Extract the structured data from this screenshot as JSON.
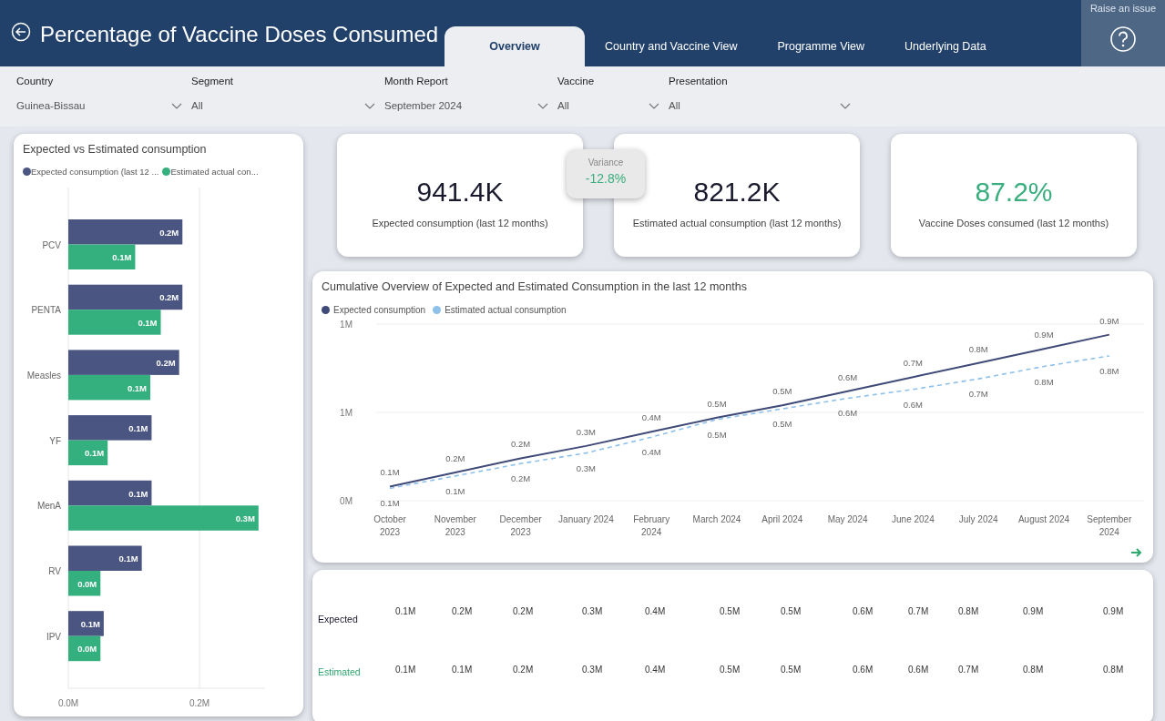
{
  "header": {
    "title": "Percentage of Vaccine Doses Consumed",
    "tabs": [
      {
        "label": "Overview",
        "selected": true
      },
      {
        "label": "Country and Vaccine View",
        "selected": false
      },
      {
        "label": "Programme View",
        "selected": false
      },
      {
        "label": "Underlying Data",
        "selected": false
      }
    ],
    "help": {
      "label": "Raise an issue"
    }
  },
  "filters": [
    {
      "label": "Country",
      "value": "Guinea-Bissau"
    },
    {
      "label": "Segment",
      "value": "All"
    },
    {
      "label": "Month Report",
      "value": "September 2024"
    },
    {
      "label": "Vaccine",
      "value": "All"
    },
    {
      "label": "Presentation",
      "value": "All"
    }
  ],
  "bar_card": {
    "chart_data": {
      "type": "bar",
      "title": "Expected vs Estimated consumption",
      "orientation": "horizontal",
      "categories": [
        "PCV",
        "PENTA",
        "Measles",
        "YF",
        "MenA",
        "RV",
        "IPV"
      ],
      "series": [
        {
          "name": "Expected consumption (last 12 ...",
          "color": "#4a5582",
          "values": [
            0.174,
            0.174,
            0.169,
            0.127,
            0.127,
            0.112,
            0.054
          ]
        },
        {
          "name": "Estimated actual con...",
          "color": "#34b07e",
          "values": [
            0.102,
            0.141,
            0.125,
            0.06,
            0.29,
            0.049,
            0.049
          ]
        }
      ],
      "xticks": [
        {
          "value": 0,
          "label": "0.0M"
        },
        {
          "value": 0.2,
          "label": "0.2M"
        }
      ],
      "xlim": [
        0,
        0.3
      ],
      "value_labels": [
        [
          "0.2M",
          "0.2M",
          "0.2M",
          "0.1M",
          "0.1M",
          "0.1M",
          "0.1M"
        ],
        [
          "0.1M",
          "0.1M",
          "0.1M",
          "0.1M",
          "0.3M",
          "0.0M",
          "0.0M"
        ]
      ]
    }
  },
  "kpis": [
    {
      "value": "941.4K",
      "label": "Expected consumption (last 12 months)",
      "color": "#1a1a2e"
    },
    {
      "value": "821.2K",
      "label": "Estimated actual consumption (last 12 months)",
      "color": "#1a1a2e"
    },
    {
      "value": "87.2%",
      "label": "Vaccine Doses consumed (last 12 months)",
      "color": "#3aae7e"
    }
  ],
  "variance": {
    "label": "Variance",
    "value": "-12.8%"
  },
  "line_card": {
    "chart_data": {
      "type": "line",
      "title": "Cumulative Overview of Expected and Estimated Consumption in the last 12 months",
      "categories": [
        "October 2023",
        "November 2023",
        "December 2023",
        "January 2024",
        "February 2024",
        "March 2024",
        "April 2024",
        "May 2024",
        "June 2024",
        "July 2024",
        "August 2024",
        "September 2024"
      ],
      "series": [
        {
          "name": "Expected consumption",
          "color": "#3f4a78",
          "values": [
            0.08,
            0.16,
            0.24,
            0.31,
            0.39,
            0.47,
            0.54,
            0.62,
            0.7,
            0.78,
            0.86,
            0.94
          ]
        },
        {
          "name": "Estimated actual consumption",
          "color": "#8ec1ea",
          "line_style": "dashed",
          "values": [
            0.07,
            0.14,
            0.21,
            0.27,
            0.36,
            0.46,
            0.52,
            0.58,
            0.63,
            0.69,
            0.76,
            0.82
          ]
        }
      ],
      "yticks": [
        {
          "value": 0,
          "label": "0M"
        },
        {
          "value": 0.5,
          "label": "1M"
        },
        {
          "value": 1,
          "label": "1M"
        }
      ],
      "ylim": [
        0,
        1
      ],
      "value_labels": [
        [
          "0.1M",
          "0.2M",
          "0.2M",
          "0.3M",
          "0.4M",
          "0.5M",
          "0.5M",
          "0.6M",
          "0.7M",
          "0.8M",
          "0.9M",
          "0.9M"
        ],
        [
          "0.1M",
          "0.1M",
          "0.2M",
          "0.3M",
          "0.4M",
          "0.5M",
          "0.5M",
          "0.6M",
          "0.6M",
          "0.7M",
          "0.8M",
          "0.8M"
        ]
      ]
    }
  },
  "table": {
    "rows": [
      {
        "label": "Expected",
        "color": "#1a1a2e",
        "cells": [
          "0.1M",
          "0.2M",
          "0.2M",
          "0.3M",
          "0.4M",
          "0.5M",
          "0.5M",
          "0.6M",
          "0.7M",
          "0.8M",
          "0.9M",
          "0.9M"
        ]
      },
      {
        "label": "Estimated",
        "color": "#2fa86e",
        "cells": [
          "0.1M",
          "0.1M",
          "0.2M",
          "0.3M",
          "0.4M",
          "0.5M",
          "0.5M",
          "0.6M",
          "0.6M",
          "0.7M",
          "0.8M",
          "0.8M"
        ]
      }
    ]
  }
}
